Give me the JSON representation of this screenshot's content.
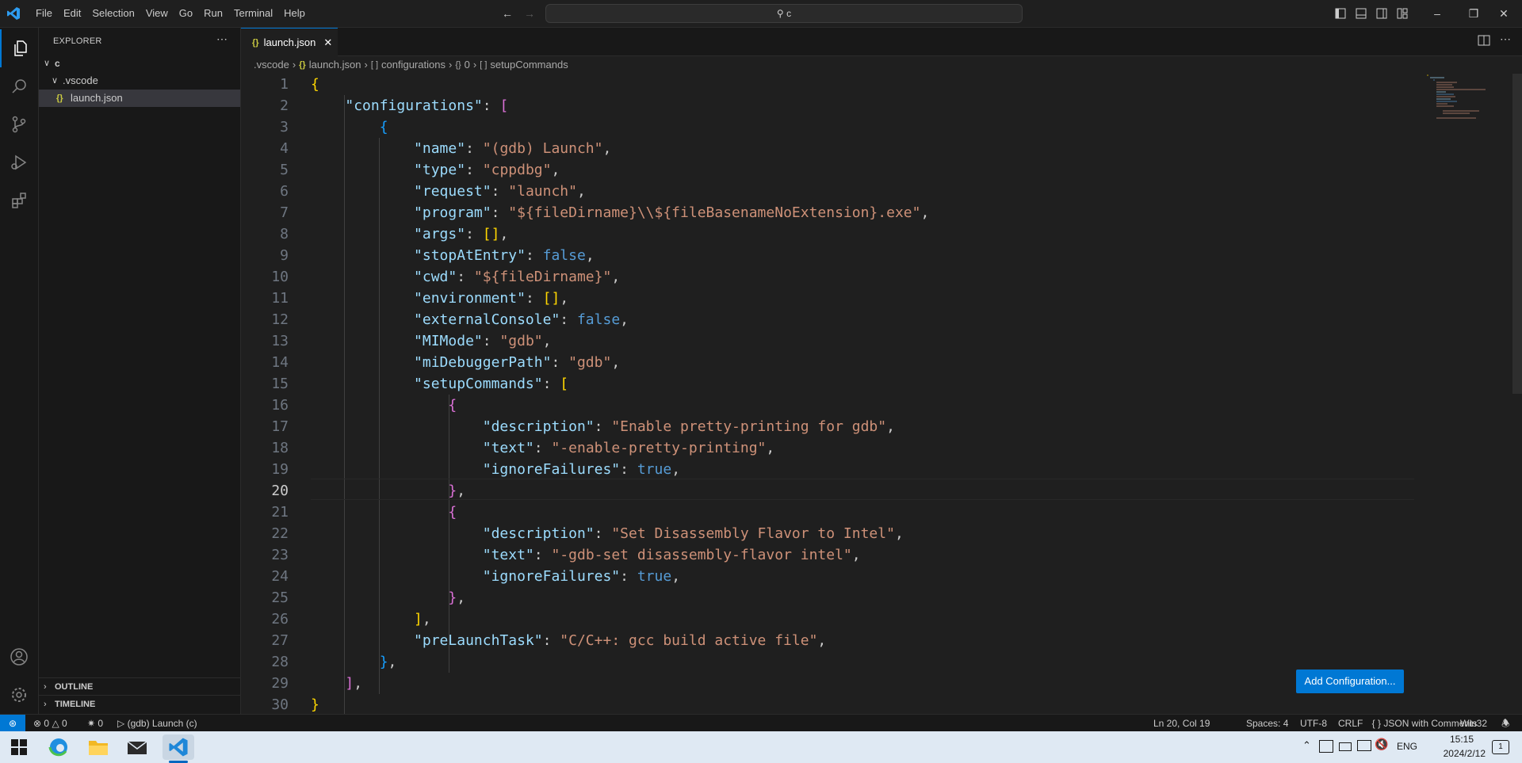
{
  "menu": [
    "File",
    "Edit",
    "Selection",
    "View",
    "Go",
    "Run",
    "Terminal",
    "Help"
  ],
  "search": {
    "text": "c"
  },
  "sidebar": {
    "title": "EXPLORER",
    "folder": "c",
    "subfolder": ".vscode",
    "file": "launch.json",
    "outline": "OUTLINE",
    "timeline": "TIMELINE"
  },
  "tab": {
    "label": "launch.json"
  },
  "breadcrumb": [
    ".vscode",
    "launch.json",
    "configurations",
    "0",
    "setupCommands"
  ],
  "editor": {
    "cursor_line": 20,
    "lines": [
      "{",
      "    \"configurations\": [",
      "        {",
      "            \"name\": \"(gdb) Launch\",",
      "            \"type\": \"cppdbg\",",
      "            \"request\": \"launch\",",
      "            \"program\": \"${fileDirname}\\\\${fileBasenameNoExtension}.exe\",",
      "            \"args\": [],",
      "            \"stopAtEntry\": false,",
      "            \"cwd\": \"${fileDirname}\",",
      "            \"environment\": [],",
      "            \"externalConsole\": false,",
      "            \"MIMode\": \"gdb\",",
      "            \"miDebuggerPath\": \"gdb\",",
      "            \"setupCommands\": [",
      "                {",
      "                    \"description\": \"Enable pretty-printing for gdb\",",
      "                    \"text\": \"-enable-pretty-printing\",",
      "                    \"ignoreFailures\": true,",
      "                },",
      "                {",
      "                    \"description\": \"Set Disassembly Flavor to Intel\",",
      "                    \"text\": \"-gdb-set disassembly-flavor intel\",",
      "                    \"ignoreFailures\": true,",
      "                },",
      "            ],",
      "            \"preLaunchTask\": \"C/C++: gcc build active file\",",
      "        },",
      "    ],",
      "}"
    ]
  },
  "add_config_button": "Add Configuration...",
  "status": {
    "errors": "0",
    "warnings": "0",
    "ports": "0",
    "debug": "(gdb) Launch (c)",
    "position": "Ln 20, Col 19",
    "spaces": "Spaces: 4",
    "encoding": "UTF-8",
    "eol": "CRLF",
    "language": "JSON with Comments",
    "platform": "Win32"
  },
  "taskbar": {
    "lang": "ENG",
    "time": "15:15",
    "date": "2024/2/12",
    "notifications": "1"
  },
  "colors": {
    "accent": "#0078d4",
    "editor_bg": "#1f1f1f",
    "key": "#9cdcfe",
    "string": "#ce9178",
    "keyword": "#569cd6"
  }
}
